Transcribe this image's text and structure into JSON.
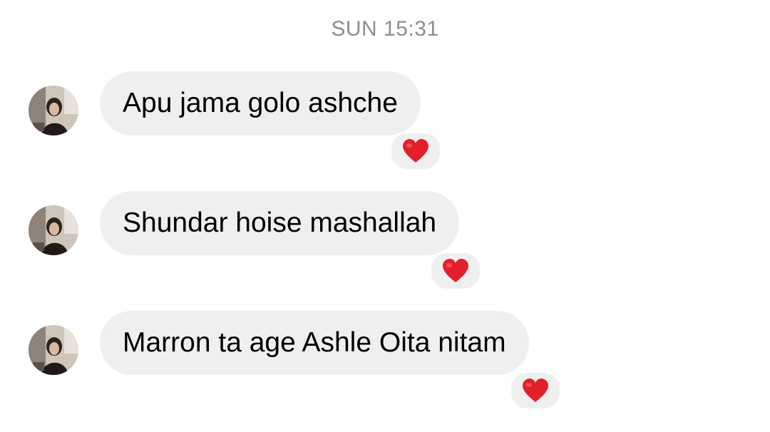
{
  "timestamp": "SUN 15:31",
  "colors": {
    "bubble": "#efefef",
    "timestamp": "#8e8e93",
    "heart": "#e2202c"
  },
  "messages": [
    {
      "text": "Apu jama golo ashche",
      "reaction": "red-heart-icon"
    },
    {
      "text": "Shundar hoise mashallah",
      "reaction": "red-heart-icon"
    },
    {
      "text": "Marron ta age Ashle Oita nitam",
      "reaction": "red-heart-icon"
    }
  ]
}
